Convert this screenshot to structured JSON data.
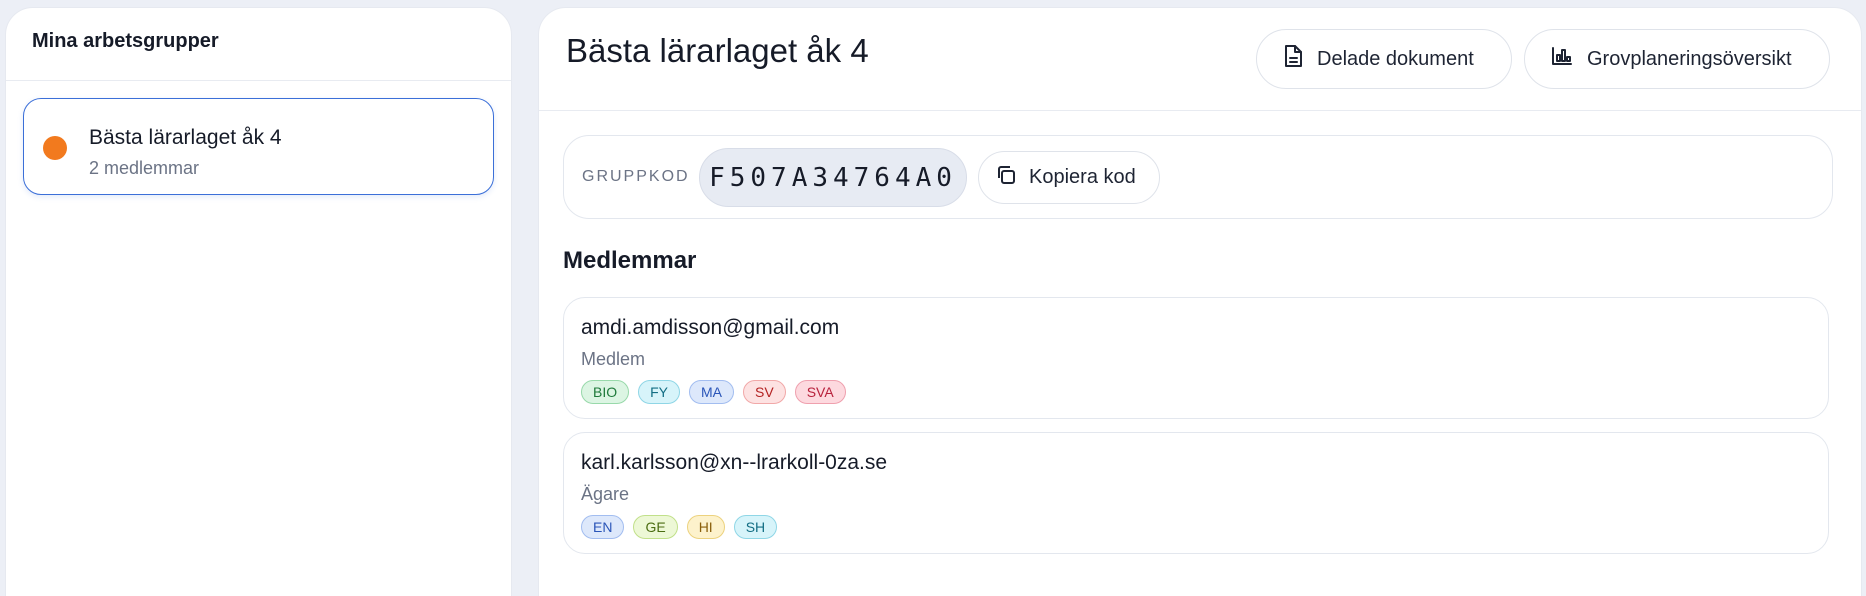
{
  "sidebar": {
    "title": "Mina arbetsgrupper",
    "groups": [
      {
        "name": "Bästa lärarlaget åk 4",
        "members": "2 medlemmar",
        "color": "#f27a1e"
      }
    ]
  },
  "main": {
    "title": "Bästa lärarlaget åk 4",
    "buttons": {
      "docs": {
        "label": "Delade dokument",
        "icon": "document-icon"
      },
      "overview": {
        "label": "Grovplaneringsöversikt",
        "icon": "bar-chart-icon"
      }
    },
    "code": {
      "label": "GRUPPKOD",
      "value": "F507A34764A0",
      "copy_label": "Kopiera kod",
      "copy_icon": "copy-icon"
    },
    "members_title": "Medlemmar",
    "members": [
      {
        "email": "amdi.amdisson@gmail.com",
        "role": "Medlem",
        "tags": [
          "BIO",
          "FY",
          "MA",
          "SV",
          "SVA"
        ]
      },
      {
        "email": "karl.karlsson@xn--lrarkoll-0za.se",
        "role": "Ägare",
        "tags": [
          "EN",
          "GE",
          "HI",
          "SH"
        ]
      }
    ]
  },
  "colors": {
    "accent": "#3b6fd8",
    "group_dot": "#f27a1e",
    "background": "#eceff6"
  }
}
